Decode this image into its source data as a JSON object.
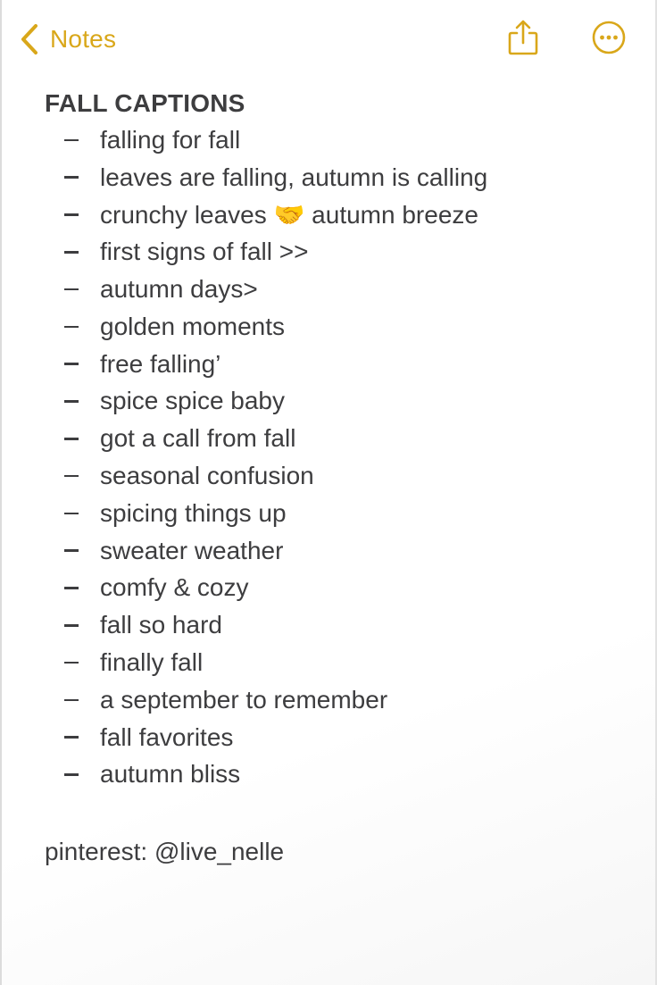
{
  "nav": {
    "back_label": "Notes",
    "back_icon": "chevron-left-icon",
    "share_icon": "share-icon",
    "more_icon": "ellipsis-circle-icon",
    "accent_color": "#d9a71a"
  },
  "note": {
    "title": "FALL CAPTIONS",
    "captions": [
      "falling for fall",
      "leaves are falling, autumn is calling",
      "crunchy leaves 🤝 autumn breeze",
      "first signs of fall >>",
      "autumn days>",
      "golden moments",
      "free falling’",
      "spice spice baby",
      "got a call from fall",
      "seasonal confusion",
      "spicing things up",
      "sweater weather",
      "comfy & cozy",
      "fall so hard",
      "finally fall",
      "a september to remember",
      "fall favorites",
      "autumn bliss"
    ],
    "footer": "pinterest: @live_nelle"
  }
}
